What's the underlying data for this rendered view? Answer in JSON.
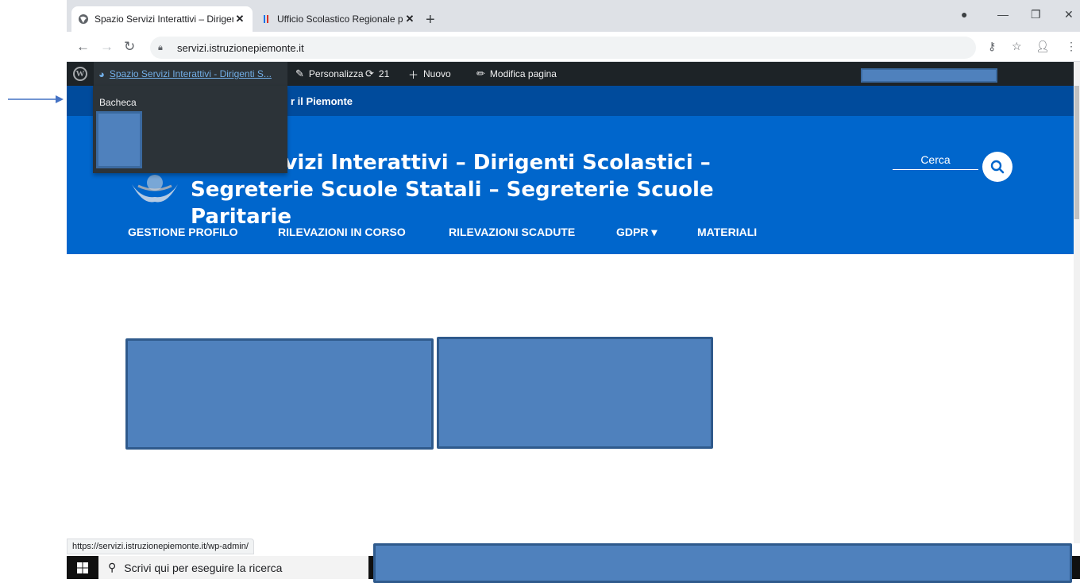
{
  "browser": {
    "tabs": [
      {
        "title": "Spazio Servizi Interattivi – Diriger",
        "active": true
      },
      {
        "title": "Ufficio Scolastico Regionale per il",
        "active": false
      }
    ],
    "url": "servizi.istruzionepiemonte.it",
    "status_url": "https://servizi.istruzionepiemonte.it/wp-admin/"
  },
  "adminbar": {
    "site_name": "Spazio Servizi Interattivi - Dirigenti S...",
    "items": [
      {
        "label": "Personalizza",
        "icon": "brush-icon"
      },
      {
        "label": "21",
        "icon": "updates-icon"
      },
      {
        "label": "Nuovo",
        "icon": "plus-icon"
      },
      {
        "label": "Modifica pagina",
        "icon": "pencil-icon"
      }
    ],
    "dropdown": {
      "item": "Bacheca"
    }
  },
  "site": {
    "topstrip": "r il Piemonte",
    "title_line1": "ervizi Interattivi – Dirigenti Scolastici –",
    "title_line2": "Segreterie Scuole Statali – Segreterie Scuole Paritarie",
    "search_label": "Cerca",
    "menu": [
      {
        "label": "GESTIONE PROFILO"
      },
      {
        "label": "RILEVAZIONI IN CORSO"
      },
      {
        "label": "RILEVAZIONI SCADUTE"
      },
      {
        "label": "GDPR ▾"
      },
      {
        "label": "MATERIALI"
      }
    ]
  },
  "taskbar": {
    "search_placeholder": "Scrivi qui per eseguire la ricerca"
  },
  "colors": {
    "header_blue": "#0066cc",
    "strip_blue": "#004b9c",
    "adminbar": "#1d2327",
    "redaction": "#4f81bd"
  }
}
